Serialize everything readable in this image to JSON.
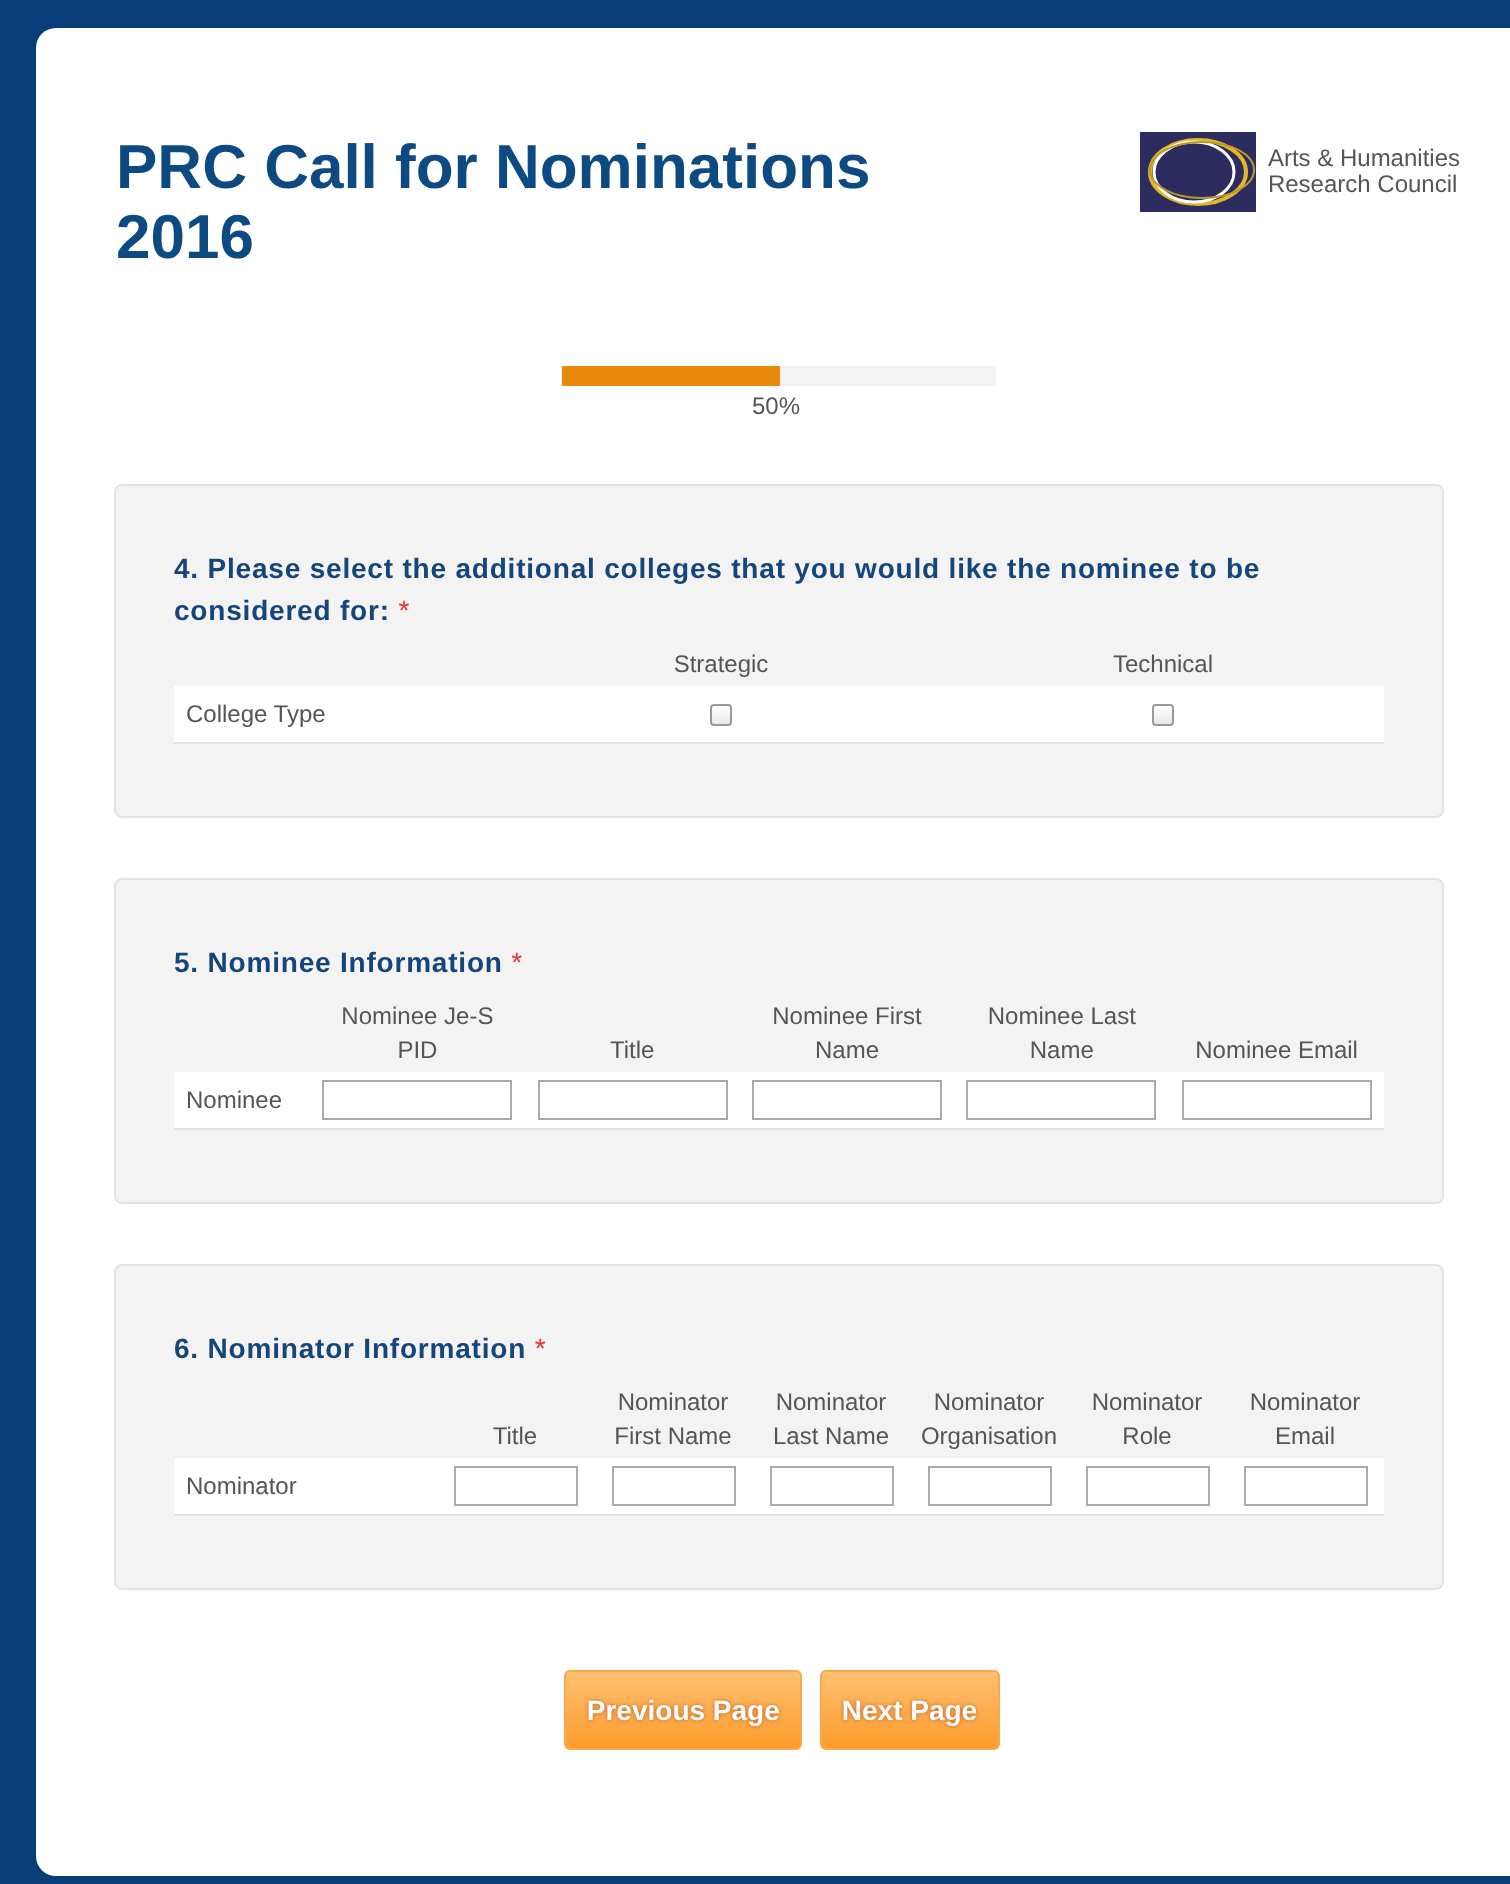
{
  "header": {
    "title": "PRC Call for Nominations 2016",
    "logo_text": [
      "Arts & Humanities",
      "Research Council"
    ]
  },
  "progress": {
    "level": 0.5,
    "label": "50%"
  },
  "questions": [
    {
      "kind": "checkbox_matrix",
      "heading": "4. Please select the additional colleges that you would like the nominee to be considered for:",
      "required_mark": "*",
      "columns": [
        "Strategic",
        "Technical"
      ],
      "rows": [
        {
          "label": "College Type",
          "cells": [
            {
              "checked": false
            },
            {
              "checked": false
            }
          ]
        }
      ]
    },
    {
      "kind": "text_matrix",
      "heading": "5. Nominee Information",
      "required_mark": "*",
      "columns": [
        "Nominee Je-S PID",
        "Title",
        "Nominee First Name",
        "Nominee Last Name",
        "Nominee Email"
      ],
      "rows": [
        {
          "label": "Nominee"
        }
      ]
    },
    {
      "kind": "text_matrix",
      "heading": "6. Nominator Information",
      "required_mark": "*",
      "columns": [
        "Title",
        "Nominator First Name",
        "Nominator Last Name",
        "Nominator Organisation",
        "Nominator Role",
        "Nominator Email"
      ],
      "rows": [
        {
          "label": "Nominator"
        }
      ]
    }
  ],
  "buttons": [
    "Previous Page",
    "Next Page"
  ]
}
